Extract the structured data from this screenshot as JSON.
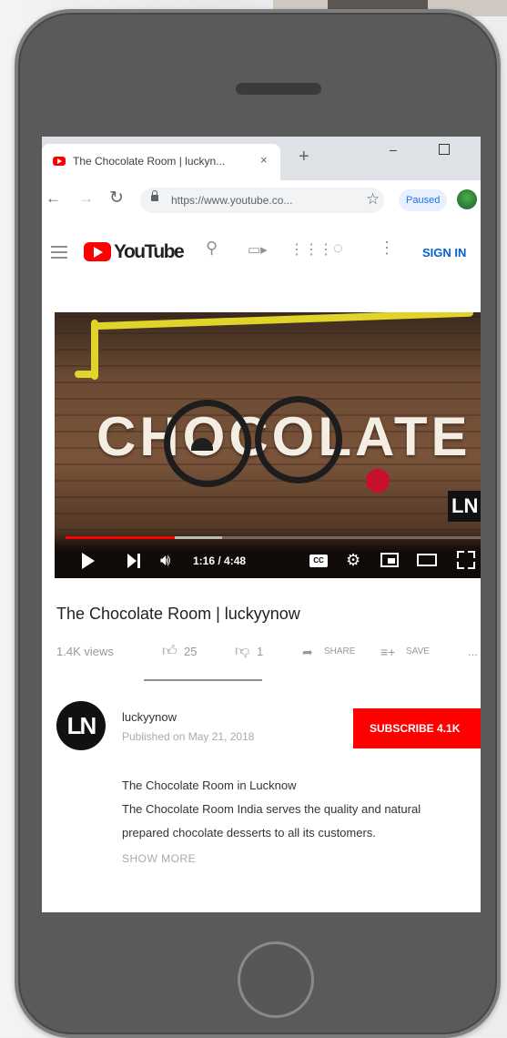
{
  "browser": {
    "tab_title": "The Chocolate Room | luckyn...",
    "tab_close": "×",
    "new_tab": "+",
    "window_minimize": "–",
    "url": "https://www.youtube.co...",
    "paused_label": "Paused"
  },
  "youtube": {
    "logo_text": "YouTube",
    "signin_label": "SIGN IN"
  },
  "video": {
    "sign_text": "CHOCOLATE",
    "watermark": "LN",
    "time": "1:16 / 4:48",
    "progress_fraction": 0.264
  },
  "info": {
    "title": "The Chocolate Room | luckyynow",
    "views": "1.4K views",
    "likes": "25",
    "dislikes": "1",
    "share_label": "SHARE",
    "save_label": "SAVE",
    "more": "..."
  },
  "channel": {
    "avatar_text": "LN",
    "name": "luckyynow",
    "published": "Published on May 21, 2018",
    "subscribe_label": "SUBSCRIBE  4.1K"
  },
  "description": {
    "line1": "The Chocolate Room in Lucknow",
    "line2": "The Chocolate Room India serves the quality and natural",
    "line3": "prepared chocolate desserts to all its customers.",
    "show_more": "SHOW MORE"
  }
}
